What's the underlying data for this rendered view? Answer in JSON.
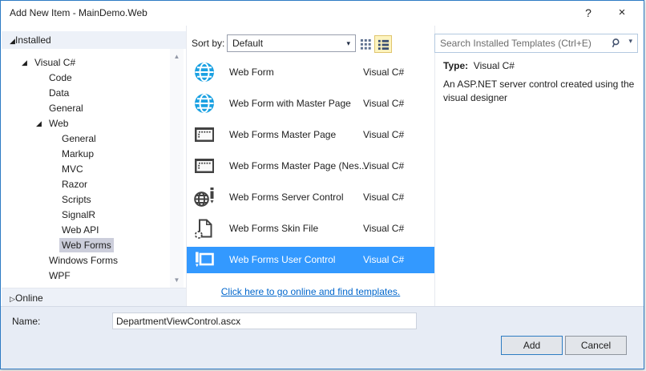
{
  "window": {
    "title": "Add New Item - MainDemo.Web",
    "help": "?",
    "close": "×"
  },
  "colors": {
    "accent_border": "#2e7bc4",
    "selection_blue": "#3399ff",
    "inactive_selection": "#cccedb",
    "link_blue": "#0066cc",
    "globe_icon_blue": "#1ba1e2",
    "icon_gray": "#424242",
    "view_button_highlight": "#fdf4bf"
  },
  "sidebar": {
    "installed": {
      "label": "Installed",
      "expanded": true
    },
    "online": {
      "label": "Online",
      "expanded": false
    },
    "tree": [
      {
        "label": "Visual C#",
        "level": 1,
        "expanded": true
      },
      {
        "label": "Code",
        "level": 2
      },
      {
        "label": "Data",
        "level": 2
      },
      {
        "label": "General",
        "level": 2
      },
      {
        "label": "Web",
        "level": 2,
        "expanded": true
      },
      {
        "label": "General",
        "level": 3
      },
      {
        "label": "Markup",
        "level": 3
      },
      {
        "label": "MVC",
        "level": 3
      },
      {
        "label": "Razor",
        "level": 3
      },
      {
        "label": "Scripts",
        "level": 3
      },
      {
        "label": "SignalR",
        "level": 3
      },
      {
        "label": "Web API",
        "level": 3
      },
      {
        "label": "Web Forms",
        "level": 3,
        "selected": true
      },
      {
        "label": "Windows Forms",
        "level": 2
      },
      {
        "label": "WPF",
        "level": 2
      }
    ]
  },
  "toolbar": {
    "sort_label": "Sort by:",
    "sort_value": "Default",
    "view_buttons": [
      "small-icons-view",
      "list-view"
    ],
    "active_view": "list-view"
  },
  "search": {
    "placeholder": "Search Installed Templates (Ctrl+E)"
  },
  "templates": {
    "items": [
      {
        "name": "Web Form",
        "lang": "Visual C#",
        "icon": "web-form-globe"
      },
      {
        "name": "Web Form with Master Page",
        "lang": "Visual C#",
        "icon": "web-form-globe"
      },
      {
        "name": "Web Forms Master Page",
        "lang": "Visual C#",
        "icon": "master-page"
      },
      {
        "name": "Web Forms Master Page (Nes...",
        "lang": "Visual C#",
        "icon": "master-page"
      },
      {
        "name": "Web Forms Server Control",
        "lang": "Visual C#",
        "icon": "server-control"
      },
      {
        "name": "Web Forms Skin File",
        "lang": "Visual C#",
        "icon": "skin-file"
      },
      {
        "name": "Web Forms User Control",
        "lang": "Visual C#",
        "icon": "user-control",
        "selected": true
      }
    ],
    "online_link": "Click here to go online and find templates."
  },
  "info": {
    "type_label": "Type:",
    "type_value": "Visual C#",
    "description": "An ASP.NET server control created using the visual designer"
  },
  "footer": {
    "name_label": "Name:",
    "name_value": "DepartmentViewControl.ascx",
    "add_label": "Add",
    "cancel_label": "Cancel"
  }
}
